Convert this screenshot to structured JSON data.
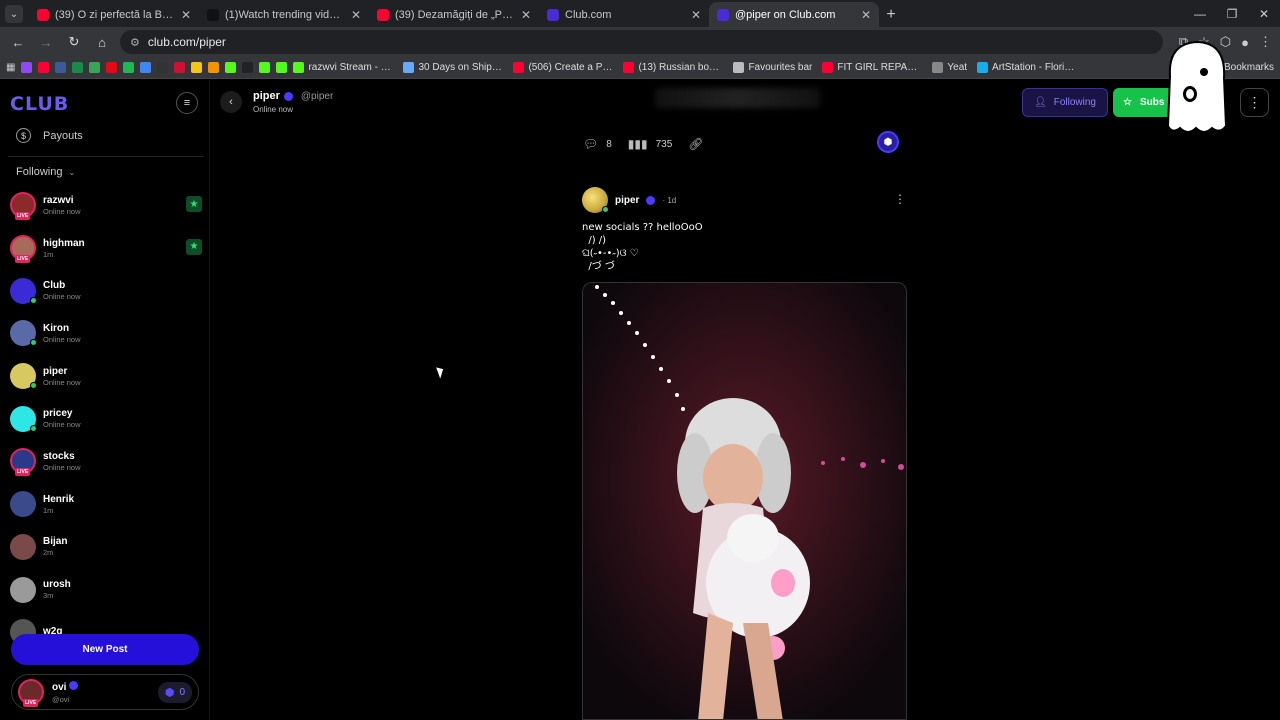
{
  "browser": {
    "tabs": [
      {
        "title": "(39) O zi perfectă la Brăila: ne-a",
        "color": "#ff0033",
        "active": false
      },
      {
        "title": "(1)Watch trending videos for yo",
        "color": "#111111",
        "active": false
      },
      {
        "title": "(39) Dezamăgiți de „Parisul” Ch",
        "color": "#ff0033",
        "active": false
      },
      {
        "title": "Club.com",
        "color": "#4b2bd6",
        "active": false
      },
      {
        "title": "@piper on Club.com",
        "color": "#4b2bd6",
        "active": true
      }
    ],
    "url": "club.com/piper",
    "bookmarks": [
      {
        "label": "razwvi Stream - Wat...",
        "color": "#53fc18"
      },
      {
        "label": "30 Days on Ship on...",
        "color": "#66aaff"
      },
      {
        "label": "(506) Create a Proce...",
        "color": "#ff0033"
      },
      {
        "label": "(13) Russian boy cry...",
        "color": "#ff0033"
      },
      {
        "label": "Favourites bar",
        "color": "#bbbbbb"
      },
      {
        "label": "FIT GIRL REPACK SE...",
        "color": "#ff0033"
      },
      {
        "label": "Yeat",
        "color": "#888888"
      },
      {
        "label": "ArtStation - Florian...",
        "color": "#13aff0"
      }
    ],
    "bookmarks_right": "Bookmarks"
  },
  "sidebar": {
    "logo": "CLUB",
    "payouts_label": "Payouts",
    "following_label": "Following",
    "following": [
      {
        "name": "razwvi",
        "status": "Online now",
        "live": true,
        "star": true,
        "color": "#8b2a2a"
      },
      {
        "name": "highman",
        "status": "1m",
        "live": true,
        "star": true,
        "color": "#a86a5a"
      },
      {
        "name": "Club",
        "status": "Online now",
        "live": false,
        "star": false,
        "color": "#3a2bd6"
      },
      {
        "name": "Kiron",
        "status": "Online now",
        "live": false,
        "star": false,
        "color": "#5a6aa8"
      },
      {
        "name": "piper",
        "status": "Online now",
        "live": false,
        "star": false,
        "color": "#d8c860"
      },
      {
        "name": "pricey",
        "status": "Online now",
        "live": false,
        "star": false,
        "color": "#2ee6e6"
      },
      {
        "name": "stocks",
        "status": "Online now",
        "live": true,
        "star": false,
        "color": "#2a3a8a"
      },
      {
        "name": "Henrik",
        "status": "1m",
        "live": false,
        "star": false,
        "color": "#3a4a8a"
      },
      {
        "name": "Bijan",
        "status": "2m",
        "live": false,
        "star": false,
        "color": "#7a4a4a"
      },
      {
        "name": "urosh",
        "status": "3m",
        "live": false,
        "star": false,
        "color": "#9a9a9a"
      },
      {
        "name": "w2g",
        "status": "",
        "live": false,
        "star": false,
        "color": "#555555"
      }
    ],
    "new_post_label": "New Post",
    "user": {
      "name": "ovi",
      "handle": "@ovi",
      "coins": "0"
    }
  },
  "header": {
    "name": "piper",
    "handle": "@piper",
    "status": "Online now",
    "following_label": "Following",
    "subscribe_label": "Subs"
  },
  "post": {
    "comments": "8",
    "views": "735",
    "author": "piper",
    "time": "· 1d",
    "text": "new socials ?? helloOoO\n  /) /)\nଘ(˶•-•˶)ଓ ♡\n  /づ づ"
  }
}
